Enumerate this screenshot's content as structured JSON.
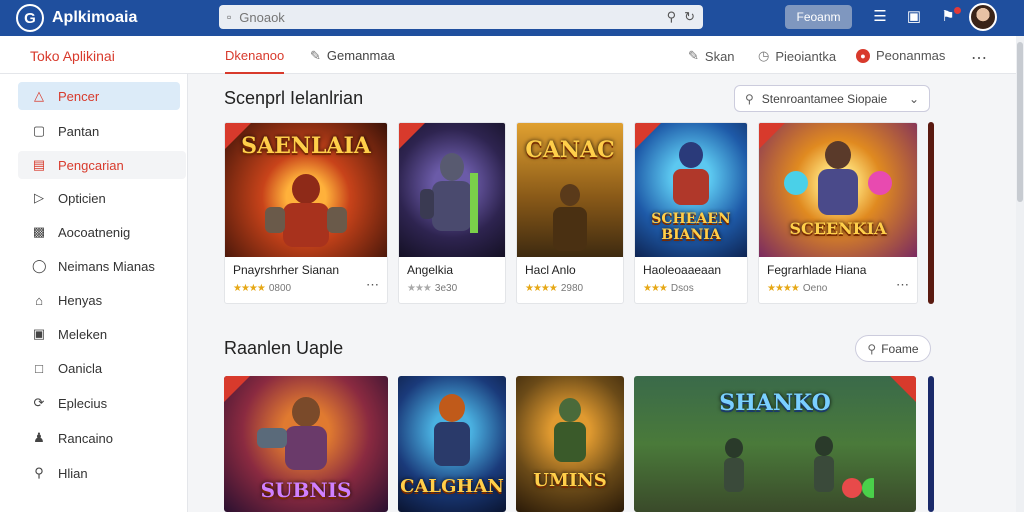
{
  "app": {
    "name": "Aplkimoaia",
    "logo_letter": "G"
  },
  "search": {
    "placeholder": "Gnoaok"
  },
  "top": {
    "button_label": "Feoanm"
  },
  "subbar": {
    "store_title": "Toko Aplikinai",
    "tabs": [
      "Dkenanoo",
      "Gemanmaa"
    ],
    "actions": [
      "Skan",
      "Pieoiantka",
      "Peonanmas"
    ]
  },
  "sidebar": {
    "items": [
      {
        "label": "Pencer",
        "icon": "warning-triangle-icon"
      },
      {
        "label": "Pantan",
        "icon": "monitor-icon"
      },
      {
        "label": "Pengcarian",
        "icon": "calendar-icon"
      },
      {
        "label": "Opticien",
        "icon": "play-square-icon"
      },
      {
        "label": "Aocoatnenig",
        "icon": "chart-square-icon"
      },
      {
        "label": "Neimans Mianas",
        "icon": "shield-icon"
      },
      {
        "label": "Henyas",
        "icon": "home-icon"
      },
      {
        "label": "Meleken",
        "icon": "image-square-icon"
      },
      {
        "label": "Oanicla",
        "icon": "chat-square-icon"
      },
      {
        "label": "Eplecius",
        "icon": "refresh-circle-icon"
      },
      {
        "label": "Rancaino",
        "icon": "user-icon"
      },
      {
        "label": "Hlian",
        "icon": "search-icon"
      }
    ]
  },
  "section1": {
    "title": "Scenprl Ielanlrian",
    "filter_label": "Stenroantamee Siopaie",
    "cards": [
      {
        "name": "Pnayrshrher Sianan",
        "rating_text": "0800",
        "art_title": "SAENLAIA",
        "theme": "fire"
      },
      {
        "name": "Angelkia",
        "rating_text": "3e30",
        "art_title": "",
        "theme": "purple"
      },
      {
        "name": "Hacl Anlo",
        "rating_text": "2980",
        "art_title": "CANAC",
        "theme": "gold"
      },
      {
        "name": "Haoleoaaeaan",
        "rating_text": "Dsos",
        "art_title": "SCHEAEN BIANIA",
        "theme": "blue"
      },
      {
        "name": "Fegrarhlade Hiana",
        "rating_text": "Oeno",
        "art_title": "SCEENKIA",
        "theme": "magic"
      }
    ]
  },
  "section2": {
    "title": "Raanlen Uaple",
    "pill_label": "Foame",
    "cards": [
      {
        "art_title": "SUBNIS",
        "theme": "fire2"
      },
      {
        "art_title": "CALGHAN",
        "theme": "blue2"
      },
      {
        "art_title": "UMINS",
        "theme": "gold2"
      },
      {
        "art_title": "SHANKO",
        "theme": "field"
      }
    ]
  },
  "colors": {
    "brand": "#1f4f9e",
    "accent": "#d83a2c",
    "sidebar_active": "#dcebf8"
  }
}
